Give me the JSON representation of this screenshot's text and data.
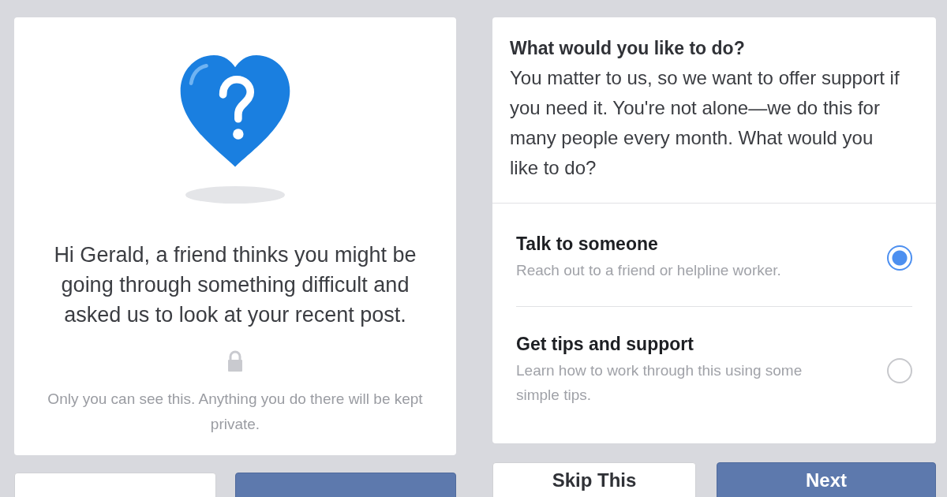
{
  "left_panel": {
    "message": "Hi Gerald, a friend thinks you might be going through something difficult and asked us to look at your recent post.",
    "privacy_note": "Only you can see this. Anything you do there will be kept private."
  },
  "left_buttons": [
    {
      "kind": "secondary"
    },
    {
      "kind": "primary"
    }
  ],
  "right_panel": {
    "heading": "What would you like to do?",
    "body": "You matter to us, so we want to offer support if you need it. You're not alone—we do this for many people every month. What would you like to do?",
    "options": [
      {
        "title": "Talk to someone",
        "description": "Reach out to a friend or helpline worker.",
        "selected": true
      },
      {
        "title": "Get tips and support",
        "description": "Learn how to work through this using some simple tips.",
        "selected": false
      }
    ]
  },
  "right_buttons": [
    {
      "label": "Skip This",
      "kind": "secondary"
    },
    {
      "label": "Next",
      "kind": "primary"
    }
  ]
}
